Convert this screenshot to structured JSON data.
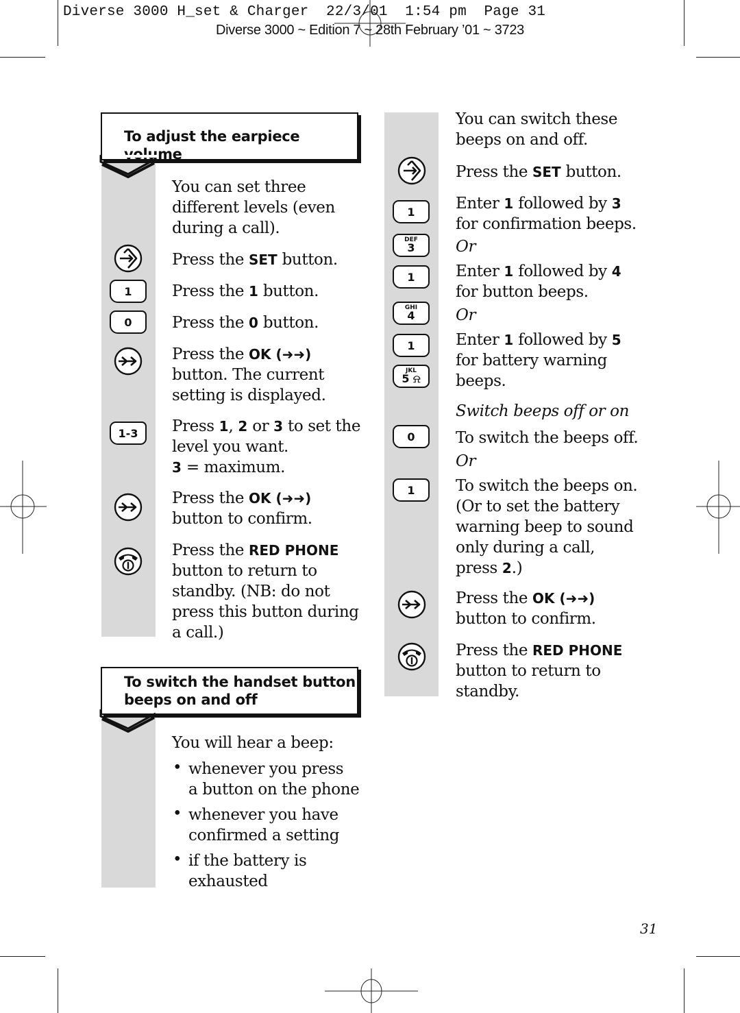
{
  "print_header": {
    "slug": "Diverse 3000 H_set & Charger  22/3/01  1:54 pm  Page 31",
    "edition": "Diverse 3000 ~ Edition 7 ~ 28th February ’01 ~ 3723"
  },
  "sections": {
    "earpiece": {
      "title": "To adjust the earpiece volume",
      "intro": [
        "You can set three",
        "different levels (even",
        "during a call)."
      ],
      "steps": [
        {
          "icon": "set-button-icon",
          "parts": [
            "Press the ",
            "SET",
            " button."
          ]
        },
        {
          "key": "1",
          "parts": [
            "Press the ",
            "1",
            " button."
          ]
        },
        {
          "key": "0",
          "parts": [
            "Press the ",
            "0",
            " button."
          ]
        },
        {
          "icon": "ok-button-icon",
          "lines": [
            "Press the |OK (➜➜)",
            "button. The current",
            "setting is displayed."
          ]
        },
        {
          "key": "1-3",
          "lines": [
            "Press |1|, |2| or |3| to set the",
            "level you want.",
            "|3| = maximum."
          ]
        },
        {
          "icon": "ok-button-icon",
          "lines": [
            "Press the |OK (➜➜)",
            "button to confirm."
          ]
        },
        {
          "icon": "red-phone-icon",
          "lines": [
            "Press the |RED PHONE",
            "button to return to",
            "standby. (NB: do not",
            "press this button during",
            "a call.)"
          ]
        }
      ]
    },
    "beeps": {
      "title_line1": "To switch the handset button",
      "title_line2": "beeps on and off",
      "intro": "You will hear a beep:",
      "bullets": [
        [
          "whenever you press",
          "a button on the phone"
        ],
        [
          "whenever you have",
          "confirmed a setting"
        ],
        [
          "if the battery is",
          "exhausted"
        ]
      ],
      "col2_intro": [
        "You can switch these",
        "beeps on and off."
      ],
      "set_step": "Press the |SET| button.",
      "confirmation_beeps": [
        "Enter |1| followed by |3",
        "for confirmation beeps."
      ],
      "or": "Or",
      "button_beeps": [
        "Enter |1| followed by |4",
        "for button beeps."
      ],
      "battery_beeps": [
        "Enter |1| followed by |5",
        "for battery warning",
        "beeps."
      ],
      "subheading": "Switch beeps off or on",
      "off_step": "To switch the beeps off.",
      "on_step": [
        "To switch the beeps on.",
        "(Or to set the battery",
        "warning beep to sound",
        "only during a call,",
        "press |2|.)"
      ],
      "ok_step": [
        "Press the |OK (➜➜)",
        "button to confirm."
      ],
      "red_step": [
        "Press the |RED PHONE",
        "button to return to",
        "standby."
      ]
    }
  },
  "keys": {
    "k1": {
      "num": "1",
      "letters": ""
    },
    "k0": {
      "num": "0",
      "letters": ""
    },
    "k13": {
      "num": "1-3",
      "letters": ""
    },
    "k3": {
      "num": "3",
      "letters": "DEF"
    },
    "k4": {
      "num": "4",
      "letters": "GHI"
    },
    "k5": {
      "num": "5 ⍾",
      "letters": "JKL"
    }
  },
  "page_number": "31"
}
